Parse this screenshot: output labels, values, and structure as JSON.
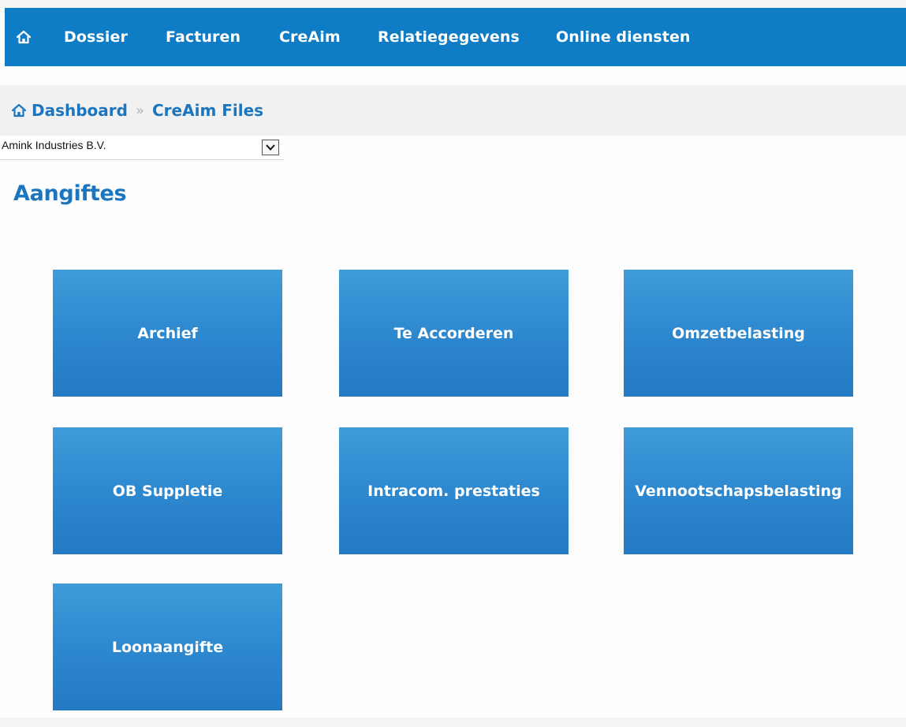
{
  "nav": {
    "home_icon": "home-icon",
    "items": [
      {
        "label": "Dossier"
      },
      {
        "label": "Facturen"
      },
      {
        "label": "CreAim"
      },
      {
        "label": "Relatiegegevens"
      },
      {
        "label": "Online diensten"
      }
    ]
  },
  "breadcrumb": {
    "home_icon": "home-icon",
    "root_label": "Dashboard",
    "separator": "»",
    "current_label": "CreAim Files"
  },
  "company_select": {
    "selected": "Amink Industries B.V."
  },
  "section": {
    "title": "Aangiftes"
  },
  "tiles": [
    {
      "label": "Archief"
    },
    {
      "label": "Te Accorderen"
    },
    {
      "label": "Omzetbelasting"
    },
    {
      "label": "OB Suppletie"
    },
    {
      "label": "Intracom. prestaties"
    },
    {
      "label": "Vennootschapsbelasting"
    },
    {
      "label": "Loonaangifte"
    }
  ],
  "colors": {
    "nav_background": "#0f7cc6",
    "accent_text": "#1b76bf",
    "tile_top": "#3f9bd9",
    "tile_bottom": "#2479c3"
  }
}
